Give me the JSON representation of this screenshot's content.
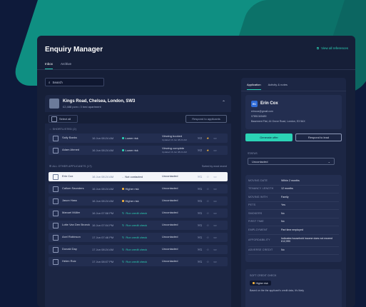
{
  "app": {
    "title": "Enquiry Manager",
    "ref_link": "View all references",
    "tabs": [
      {
        "label": "Inbox",
        "active": true
      },
      {
        "label": "Archive",
        "active": false
      }
    ]
  },
  "search": {
    "placeholder": "Search"
  },
  "property": {
    "title": "Kings Road, Chelsea, London, SW3",
    "subtitle": "£2,488 pcm • 3 bed apartment"
  },
  "toolbar": {
    "select_all": "Select all",
    "respond": "Respond to applicants"
  },
  "sections": {
    "shortlisted": "SHORTLISTED (2)",
    "all_other": "ALL OTHER APPLICANTS (17)",
    "sorted": "Sorted by most recent"
  },
  "shortlisted": [
    {
      "name": "Sally Banks",
      "date": "16 Jun 08:24 AM",
      "risk": "Lower risk",
      "status": "Viewing booked",
      "status_sub": "Updated 16 Jun 08:24 AM",
      "count": "2",
      "starred": true
    },
    {
      "name": "Adam Ahmed",
      "date": "16 Jun 08:24 AM",
      "risk": "Lower risk",
      "status": "Viewing complete",
      "status_sub": "Updated 16 Jun 08:24 AM",
      "count": "2",
      "starred": true
    }
  ],
  "others": [
    {
      "name": "Erin Cox",
      "date": "16 Jun 08:24 AM",
      "risk": "Not contacted",
      "status": "Uncontacted",
      "count": "1",
      "selected": true
    },
    {
      "name": "Callum Saunders",
      "date": "16 Jun 08:24 AM",
      "risk": "Higher risk",
      "status": "Uncontacted",
      "count": "1"
    },
    {
      "name": "Jason Hass",
      "date": "16 Jun 08:24 AM",
      "risk": "Higher risk",
      "status": "Uncontacted",
      "count": "1"
    },
    {
      "name": "Manuel Müller",
      "date": "16 Jun 07:58 PM",
      "risk": "Run credit check",
      "status": "Uncontacted",
      "count": "1"
    },
    {
      "name": "Lotte Van Den Broeck",
      "date": "16 Jun 07:04 PM",
      "risk": "Run credit check",
      "status": "Uncontacted",
      "count": "1"
    },
    {
      "name": "Axel Robinson",
      "date": "17 Jun 07:46 PM",
      "risk": "Run credit check",
      "status": "Uncontacted",
      "count": "1"
    },
    {
      "name": "Donald Day",
      "date": "17 Jun 08:24 AM",
      "risk": "Run credit check",
      "status": "Uncontacted",
      "count": "1"
    },
    {
      "name": "Helen Ruiz",
      "date": "17 Jun 08:07 PM",
      "risk": "Run credit check",
      "status": "Uncontacted",
      "count": "1"
    }
  ],
  "panel": {
    "tabs": [
      {
        "label": "Application",
        "active": true
      },
      {
        "label": "Activity & notes",
        "active": false
      }
    ],
    "initials": "EC",
    "name": "Erin Cox",
    "email": "erincox@gmail.com",
    "phone": "07851345489",
    "address": "Basement Flat, 44 Grove Road, London, E3 5AX",
    "generate_offer": "Generate offer",
    "respond_lead": "Respond to lead",
    "status_label": "STATUS",
    "status_value": "Uncontacted",
    "details": [
      {
        "k": "MOVING DATE",
        "v": "Within 2 months"
      },
      {
        "k": "TENANCY LENGTH",
        "v": "12 months"
      },
      {
        "k": "MOVING WITH",
        "v": "Family"
      },
      {
        "k": "PETS",
        "v": "Yes"
      },
      {
        "k": "SMOKERS",
        "v": "No"
      },
      {
        "k": "FIRST TIME",
        "v": "No"
      },
      {
        "k": "EMPLOYMENT",
        "v": "Part time employed"
      },
      {
        "k": "AFFORDABILITY",
        "v": "Indicates household income does not exceed £12,990"
      },
      {
        "k": "ADVERSE CREDIT",
        "v": "No"
      }
    ],
    "credit_label": "SOFT CREDIT CHECK",
    "credit_badge": "Higher risk",
    "credit_text": "Based on the the applicant's credit data, it's likely"
  },
  "colors": {
    "lower_risk": "#2bd3b5",
    "higher_risk": "#f3b33d",
    "credit_check": "#2bd3b5",
    "not_contacted": "#8e99b8",
    "accent": "#2bd3b5"
  }
}
